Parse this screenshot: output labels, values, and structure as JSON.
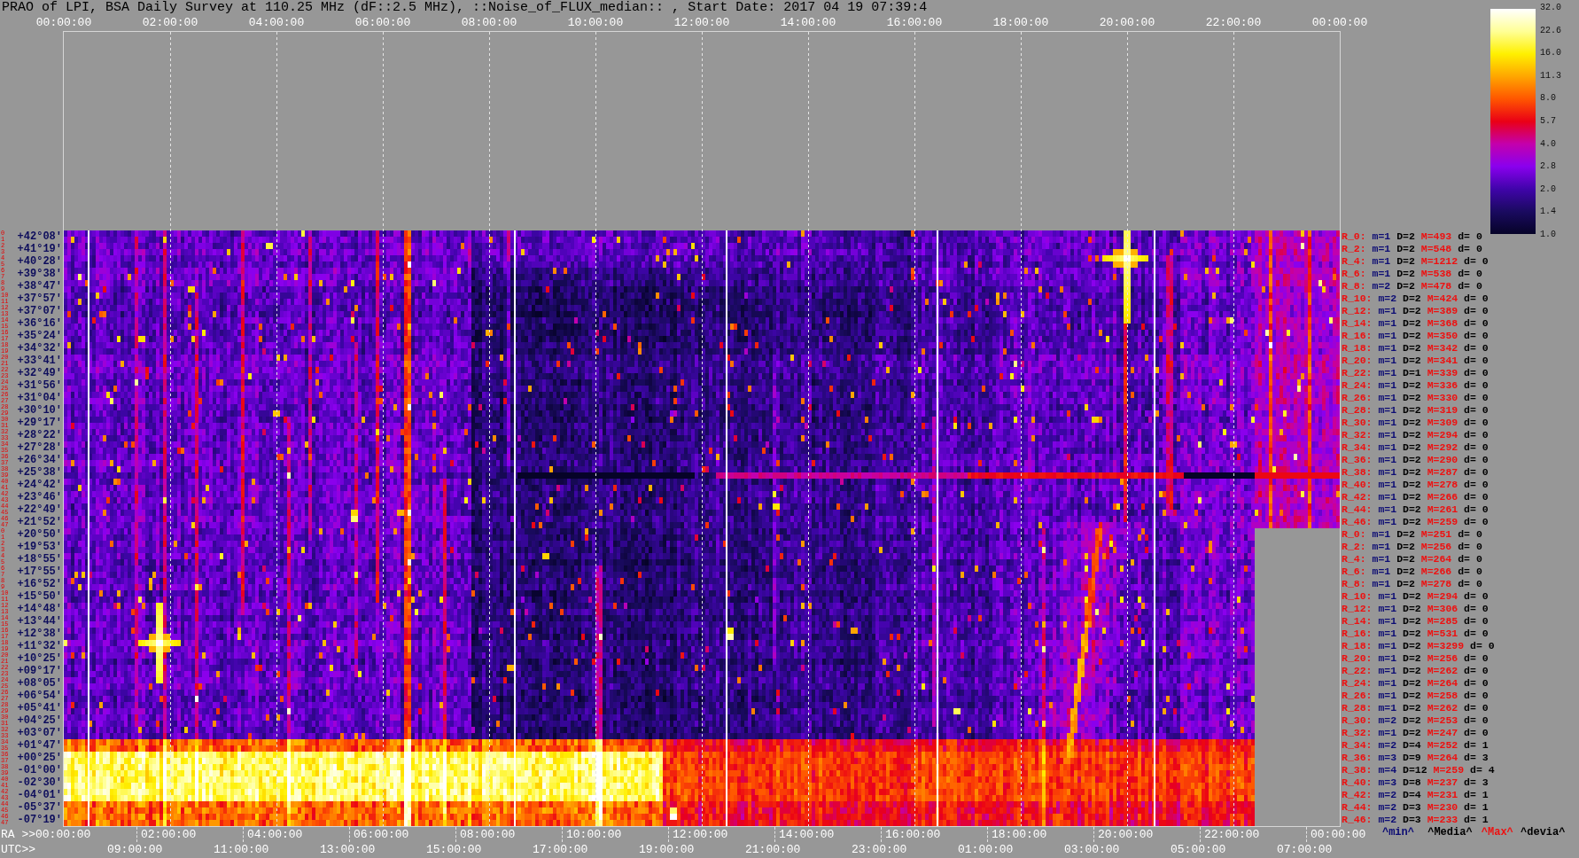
{
  "title": "PRAO of LPI, BSA Daily Survey at 110.25 MHz (dF::2.5 MHz), ::Noise_of_FLUX_median:: , Start Date: 2017 04 19 07:39:4",
  "time_axis": [
    "00:00:00",
    "02:00:00",
    "04:00:00",
    "06:00:00",
    "08:00:00",
    "10:00:00",
    "12:00:00",
    "14:00:00",
    "16:00:00",
    "18:00:00",
    "20:00:00",
    "22:00:00",
    "00:00:00"
  ],
  "color_scale": {
    "ticks": [
      "32.0",
      "22.6",
      "16.0",
      "11.3",
      "8.0",
      "5.7",
      "4.0",
      "2.8",
      "2.0",
      "1.4",
      "1.0"
    ]
  },
  "declination_axis": [
    {
      "indices": [
        "0",
        "1"
      ],
      "label": "+42°08′"
    },
    {
      "indices": [
        "2",
        "3"
      ],
      "label": "+41°19′"
    },
    {
      "indices": [
        "4",
        "5"
      ],
      "label": "+40°28′"
    },
    {
      "indices": [
        "6",
        "7"
      ],
      "label": "+39°38′"
    },
    {
      "indices": [
        "8",
        "9"
      ],
      "label": "+38°47′"
    },
    {
      "indices": [
        "10",
        "11"
      ],
      "label": "+37°57′"
    },
    {
      "indices": [
        "12",
        "13"
      ],
      "label": "+37°07′"
    },
    {
      "indices": [
        "14",
        "15"
      ],
      "label": "+36°16′"
    },
    {
      "indices": [
        "16",
        "17"
      ],
      "label": "+35°24′"
    },
    {
      "indices": [
        "18",
        "19"
      ],
      "label": "+34°32′"
    },
    {
      "indices": [
        "20",
        "21"
      ],
      "label": "+33°41′"
    },
    {
      "indices": [
        "22",
        "23"
      ],
      "label": "+32°49′"
    },
    {
      "indices": [
        "24",
        "25"
      ],
      "label": "+31°56′"
    },
    {
      "indices": [
        "26",
        "27"
      ],
      "label": "+31°04′"
    },
    {
      "indices": [
        "28",
        "29"
      ],
      "label": "+30°10′"
    },
    {
      "indices": [
        "30",
        "31"
      ],
      "label": "+29°17′"
    },
    {
      "indices": [
        "32",
        "33"
      ],
      "label": "+28°22′"
    },
    {
      "indices": [
        "34",
        "35"
      ],
      "label": "+27°28′"
    },
    {
      "indices": [
        "36",
        "37"
      ],
      "label": "+26°34′"
    },
    {
      "indices": [
        "38",
        "39"
      ],
      "label": "+25°38′"
    },
    {
      "indices": [
        "40",
        "41"
      ],
      "label": "+24°42′"
    },
    {
      "indices": [
        "42",
        "43"
      ],
      "label": "+23°46′"
    },
    {
      "indices": [
        "44",
        "45"
      ],
      "label": "+22°49′"
    },
    {
      "indices": [
        "46",
        "47"
      ],
      "label": "+21°52′"
    },
    {
      "indices": [
        "0",
        "1"
      ],
      "label": "+20°50′"
    },
    {
      "indices": [
        "2",
        "3"
      ],
      "label": "+19°53′"
    },
    {
      "indices": [
        "4",
        "5"
      ],
      "label": "+18°55′"
    },
    {
      "indices": [
        "6",
        "7"
      ],
      "label": "+17°55′"
    },
    {
      "indices": [
        "8",
        "9"
      ],
      "label": "+16°52′"
    },
    {
      "indices": [
        "10",
        "11"
      ],
      "label": "+15°50′"
    },
    {
      "indices": [
        "12",
        "13"
      ],
      "label": "+14°48′"
    },
    {
      "indices": [
        "14",
        "15"
      ],
      "label": "+13°44′"
    },
    {
      "indices": [
        "16",
        "17"
      ],
      "label": "+12°38′"
    },
    {
      "indices": [
        "18",
        "19"
      ],
      "label": "+11°32′"
    },
    {
      "indices": [
        "20",
        "21"
      ],
      "label": "+10°25′"
    },
    {
      "indices": [
        "22",
        "23"
      ],
      "label": "+09°17′"
    },
    {
      "indices": [
        "24",
        "25"
      ],
      "label": "+08°05′"
    },
    {
      "indices": [
        "26",
        "27"
      ],
      "label": "+06°54′"
    },
    {
      "indices": [
        "28",
        "29"
      ],
      "label": "+05°41′"
    },
    {
      "indices": [
        "30",
        "31"
      ],
      "label": "+04°25′"
    },
    {
      "indices": [
        "32",
        "33"
      ],
      "label": "+03°07′"
    },
    {
      "indices": [
        "34",
        "35"
      ],
      "label": "+01°47′"
    },
    {
      "indices": [
        "36",
        "37"
      ],
      "label": "+00°25′"
    },
    {
      "indices": [
        "38",
        "39"
      ],
      "label": "-01°00′"
    },
    {
      "indices": [
        "40",
        "41"
      ],
      "label": "-02°30′"
    },
    {
      "indices": [
        "42",
        "43"
      ],
      "label": "-04°01′"
    },
    {
      "indices": [
        "44",
        "45"
      ],
      "label": "-05°37′"
    },
    {
      "indices": [
        "46",
        "47"
      ],
      "label": "-07°19′"
    }
  ],
  "region_stats": [
    {
      "label": "R_0:",
      "min": "m=1",
      "median": "D=2",
      "max": "M=493",
      "deviation": "d= 0"
    },
    {
      "label": "R_2:",
      "min": "m=1",
      "median": "D=2",
      "max": "M=548",
      "deviation": "d= 0"
    },
    {
      "label": "R_4:",
      "min": "m=1",
      "median": "D=2",
      "max": "M=1212",
      "deviation": "d= 0"
    },
    {
      "label": "R_6:",
      "min": "m=1",
      "median": "D=2",
      "max": "M=538",
      "deviation": "d= 0"
    },
    {
      "label": "R_8:",
      "min": "m=2",
      "median": "D=2",
      "max": "M=478",
      "deviation": "d= 0"
    },
    {
      "label": "R_10:",
      "min": "m=2",
      "median": "D=2",
      "max": "M=424",
      "deviation": "d= 0"
    },
    {
      "label": "R_12:",
      "min": "m=1",
      "median": "D=2",
      "max": "M=389",
      "deviation": "d= 0"
    },
    {
      "label": "R_14:",
      "min": "m=1",
      "median": "D=2",
      "max": "M=368",
      "deviation": "d= 0"
    },
    {
      "label": "R_16:",
      "min": "m=1",
      "median": "D=2",
      "max": "M=350",
      "deviation": "d= 0"
    },
    {
      "label": "R_18:",
      "min": "m=1",
      "median": "D=2",
      "max": "M=342",
      "deviation": "d= 0"
    },
    {
      "label": "R_20:",
      "min": "m=1",
      "median": "D=2",
      "max": "M=341",
      "deviation": "d= 0"
    },
    {
      "label": "R_22:",
      "min": "m=1",
      "median": "D=1",
      "max": "M=339",
      "deviation": "d= 0"
    },
    {
      "label": "R_24:",
      "min": "m=1",
      "median": "D=2",
      "max": "M=336",
      "deviation": "d= 0"
    },
    {
      "label": "R_26:",
      "min": "m=1",
      "median": "D=2",
      "max": "M=330",
      "deviation": "d= 0"
    },
    {
      "label": "R_28:",
      "min": "m=1",
      "median": "D=2",
      "max": "M=319",
      "deviation": "d= 0"
    },
    {
      "label": "R_30:",
      "min": "m=1",
      "median": "D=2",
      "max": "M=309",
      "deviation": "d= 0"
    },
    {
      "label": "R_32:",
      "min": "m=1",
      "median": "D=2",
      "max": "M=294",
      "deviation": "d= 0"
    },
    {
      "label": "R_34:",
      "min": "m=1",
      "median": "D=2",
      "max": "M=292",
      "deviation": "d= 0"
    },
    {
      "label": "R_36:",
      "min": "m=1",
      "median": "D=2",
      "max": "M=290",
      "deviation": "d= 0"
    },
    {
      "label": "R_38:",
      "min": "m=1",
      "median": "D=2",
      "max": "M=287",
      "deviation": "d= 0"
    },
    {
      "label": "R_40:",
      "min": "m=1",
      "median": "D=2",
      "max": "M=278",
      "deviation": "d= 0"
    },
    {
      "label": "R_42:",
      "min": "m=1",
      "median": "D=2",
      "max": "M=266",
      "deviation": "d= 0"
    },
    {
      "label": "R_44:",
      "min": "m=1",
      "median": "D=2",
      "max": "M=261",
      "deviation": "d= 0"
    },
    {
      "label": "R_46:",
      "min": "m=1",
      "median": "D=2",
      "max": "M=259",
      "deviation": "d= 0"
    },
    {
      "label": "R_0:",
      "min": "m=1",
      "median": "D=2",
      "max": "M=251",
      "deviation": "d= 0"
    },
    {
      "label": "R_2:",
      "min": "m=1",
      "median": "D=2",
      "max": "M=256",
      "deviation": "d= 0"
    },
    {
      "label": "R_4:",
      "min": "m=1",
      "median": "D=2",
      "max": "M=264",
      "deviation": "d= 0"
    },
    {
      "label": "R_6:",
      "min": "m=1",
      "median": "D=2",
      "max": "M=266",
      "deviation": "d= 0"
    },
    {
      "label": "R_8:",
      "min": "m=1",
      "median": "D=2",
      "max": "M=278",
      "deviation": "d= 0"
    },
    {
      "label": "R_10:",
      "min": "m=1",
      "median": "D=2",
      "max": "M=294",
      "deviation": "d= 0"
    },
    {
      "label": "R_12:",
      "min": "m=1",
      "median": "D=2",
      "max": "M=306",
      "deviation": "d= 0"
    },
    {
      "label": "R_14:",
      "min": "m=1",
      "median": "D=2",
      "max": "M=285",
      "deviation": "d= 0"
    },
    {
      "label": "R_16:",
      "min": "m=1",
      "median": "D=2",
      "max": "M=531",
      "deviation": "d= 0"
    },
    {
      "label": "R_18:",
      "min": "m=1",
      "median": "D=2",
      "max": "M=3299",
      "deviation": "d= 0"
    },
    {
      "label": "R_20:",
      "min": "m=1",
      "median": "D=2",
      "max": "M=256",
      "deviation": "d= 0"
    },
    {
      "label": "R_22:",
      "min": "m=1",
      "median": "D=2",
      "max": "M=262",
      "deviation": "d= 0"
    },
    {
      "label": "R_24:",
      "min": "m=1",
      "median": "D=2",
      "max": "M=264",
      "deviation": "d= 0"
    },
    {
      "label": "R_26:",
      "min": "m=1",
      "median": "D=2",
      "max": "M=258",
      "deviation": "d= 0"
    },
    {
      "label": "R_28:",
      "min": "m=1",
      "median": "D=2",
      "max": "M=262",
      "deviation": "d= 0"
    },
    {
      "label": "R_30:",
      "min": "m=2",
      "median": "D=2",
      "max": "M=253",
      "deviation": "d= 0"
    },
    {
      "label": "R_32:",
      "min": "m=1",
      "median": "D=2",
      "max": "M=247",
      "deviation": "d= 0"
    },
    {
      "label": "R_34:",
      "min": "m=2",
      "median": "D=4",
      "max": "M=252",
      "deviation": "d= 1"
    },
    {
      "label": "R_36:",
      "min": "m=3",
      "median": "D=9",
      "max": "M=264",
      "deviation": "d= 3"
    },
    {
      "label": "R_38:",
      "min": "m=4",
      "median": "D=12",
      "max": "M=259",
      "deviation": "d= 4"
    },
    {
      "label": "R_40:",
      "min": "m=3",
      "median": "D=8",
      "max": "M=237",
      "deviation": "d= 3"
    },
    {
      "label": "R_42:",
      "min": "m=2",
      "median": "D=4",
      "max": "M=231",
      "deviation": "d= 1"
    },
    {
      "label": "R_44:",
      "min": "m=2",
      "median": "D=3",
      "max": "M=230",
      "deviation": "d= 1"
    },
    {
      "label": "R_46:",
      "min": "m=2",
      "median": "D=3",
      "max": "M=233",
      "deviation": "d= 1"
    }
  ],
  "stats_legend": {
    "min": "^min^",
    "median": "^Media^",
    "max": "^Max^",
    "deviation": "^devia^"
  },
  "ra_axis": {
    "title": "RA >>",
    "labels": [
      "00:00:00",
      "02:00:00",
      "04:00:00",
      "06:00:00",
      "08:00:00",
      "10:00:00",
      "12:00:00",
      "14:00:00",
      "16:00:00",
      "18:00:00",
      "20:00:00",
      "22:00:00",
      "00:00:00"
    ]
  },
  "utc_axis": {
    "title": "UTC>>",
    "labels": [
      "09:00:00",
      "11:00:00",
      "13:00:00",
      "15:00:00",
      "17:00:00",
      "19:00:00",
      "21:00:00",
      "23:00:00",
      "01:00:00",
      "03:00:00",
      "05:00:00",
      "07:00:00"
    ]
  }
}
